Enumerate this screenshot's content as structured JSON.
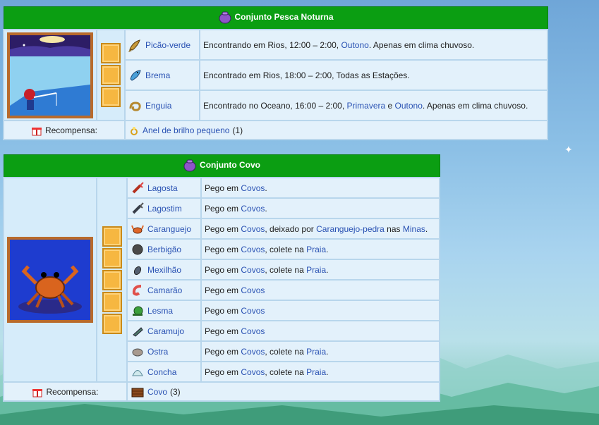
{
  "bundles": [
    {
      "title": "Conjunto Pesca Noturna",
      "items": [
        {
          "name": "Picão-verde",
          "icon": "fish-icon",
          "desc": [
            {
              "t": "Encontrando em Rios, 12:00 – 2:00, "
            },
            {
              "l": "Outono"
            },
            {
              "t": ". Apenas em clima chuvoso."
            }
          ]
        },
        {
          "name": "Brema",
          "icon": "fish-icon",
          "desc": [
            {
              "t": "Encontrado em Rios, 18:00 – 2:00, Todas as Estações."
            }
          ]
        },
        {
          "name": "Enguia",
          "icon": "eel-icon",
          "desc": [
            {
              "t": "Encontrado no Oceano, 16:00 – 2:00, "
            },
            {
              "l": "Primavera"
            },
            {
              "t": " e "
            },
            {
              "l": "Outono"
            },
            {
              "t": ". Apenas em clima chuvoso."
            }
          ]
        }
      ],
      "reward_label": "Recompensa:",
      "reward_item": "Anel de brilho pequeno",
      "reward_qty": "(1)"
    },
    {
      "title": "Conjunto Covo",
      "items": [
        {
          "name": "Lagosta",
          "desc": [
            {
              "t": "Pego em "
            },
            {
              "l": "Covos"
            },
            {
              "t": "."
            }
          ]
        },
        {
          "name": "Lagostim",
          "desc": [
            {
              "t": "Pego em "
            },
            {
              "l": "Covos"
            },
            {
              "t": "."
            }
          ]
        },
        {
          "name": "Caranguejo",
          "desc": [
            {
              "t": "Pego em "
            },
            {
              "l": "Covos"
            },
            {
              "t": ", deixado por "
            },
            {
              "l": "Caranguejo-pedra"
            },
            {
              "t": " nas "
            },
            {
              "l": "Minas"
            },
            {
              "t": "."
            }
          ]
        },
        {
          "name": "Berbigão",
          "desc": [
            {
              "t": "Pego em "
            },
            {
              "l": "Covos"
            },
            {
              "t": ", colete na "
            },
            {
              "l": "Praia"
            },
            {
              "t": "."
            }
          ]
        },
        {
          "name": "Mexilhão",
          "desc": [
            {
              "t": "Pego em "
            },
            {
              "l": "Covos"
            },
            {
              "t": ", colete na "
            },
            {
              "l": "Praia"
            },
            {
              "t": "."
            }
          ]
        },
        {
          "name": "Camarão",
          "desc": [
            {
              "t": "Pego em "
            },
            {
              "l": "Covos"
            }
          ]
        },
        {
          "name": "Lesma",
          "desc": [
            {
              "t": "Pego em "
            },
            {
              "l": "Covos"
            }
          ]
        },
        {
          "name": "Caramujo",
          "desc": [
            {
              "t": "Pego em "
            },
            {
              "l": "Covos"
            }
          ]
        },
        {
          "name": "Ostra",
          "desc": [
            {
              "t": "Pego em "
            },
            {
              "l": "Covos"
            },
            {
              "t": ", colete na "
            },
            {
              "l": "Praia"
            },
            {
              "t": "."
            }
          ]
        },
        {
          "name": "Concha",
          "desc": [
            {
              "t": "Pego em "
            },
            {
              "l": "Covos"
            },
            {
              "t": ", colete na "
            },
            {
              "l": "Praia"
            },
            {
              "t": "."
            }
          ]
        }
      ],
      "reward_label": "Recompensa:",
      "reward_item": "Covo",
      "reward_qty": "(3)"
    }
  ],
  "colors": {
    "header": "#0b9e12",
    "link": "#2a52b3",
    "slot": "#f6b741"
  }
}
